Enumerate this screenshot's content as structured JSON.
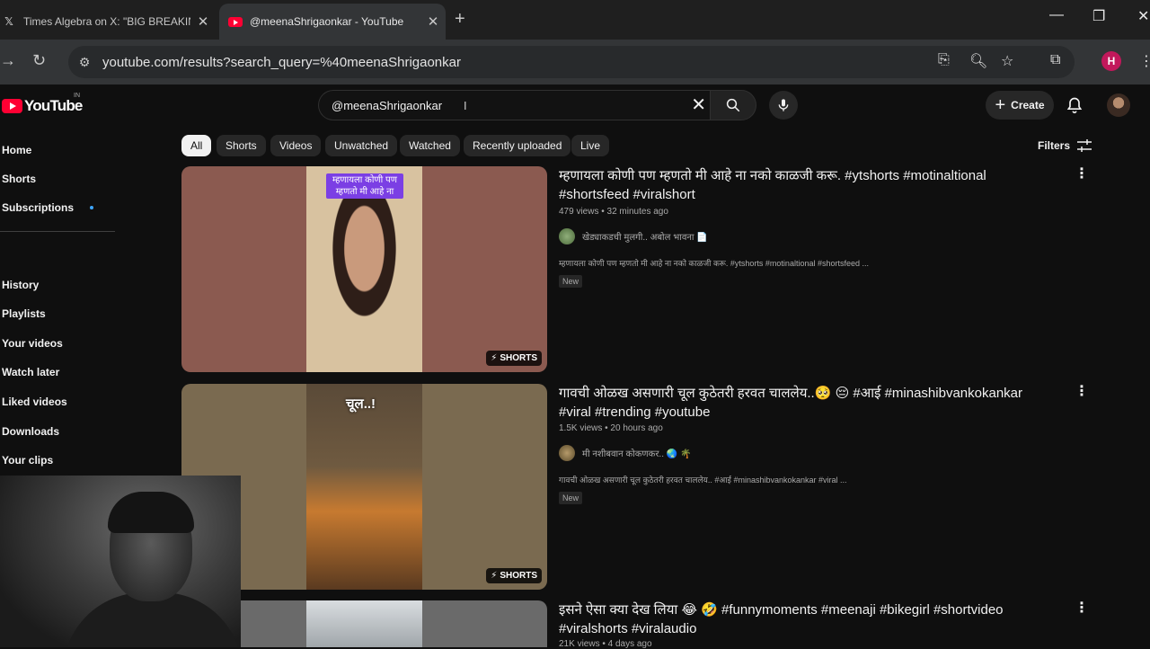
{
  "browser": {
    "tabs": [
      {
        "title": "Times Algebra on X: \"BIG BREAKING N",
        "icon": "x-logo-icon",
        "active": false
      },
      {
        "title": "@meenaShrigaonkar - YouTube",
        "icon": "youtube-icon",
        "active": true
      }
    ],
    "url": "youtube.com/results?search_query=%40meenaShrigaonkar",
    "profile_initial": "H"
  },
  "youtube": {
    "logo_text": "YouTube",
    "country_code": "IN",
    "search_query": "@meenaShrigaonkar",
    "create_label": "Create"
  },
  "sidebar": {
    "items": [
      {
        "label": "Home"
      },
      {
        "label": "Shorts"
      },
      {
        "label": "Subscriptions"
      },
      {
        "label": "History"
      },
      {
        "label": "Playlists"
      },
      {
        "label": "Your videos"
      },
      {
        "label": "Watch later"
      },
      {
        "label": "Liked videos"
      },
      {
        "label": "Downloads"
      },
      {
        "label": "Your clips"
      }
    ]
  },
  "chips": [
    "All",
    "Shorts",
    "Videos",
    "Unwatched",
    "Watched",
    "Recently uploaded",
    "Live"
  ],
  "filters_label": "Filters",
  "results": [
    {
      "title_line1": "म्हणायला कोणी पण म्हणतो मी आहे ना नको काळजी करू. #ytshorts #motinaltional",
      "title_line2": "#shortsfeed #viralshort",
      "meta": "479 views • 32 minutes ago",
      "channel": "खेड्याकडची मुलगी.. अबोल भावना 📄",
      "description": "म्हणायला कोणी पण म्हणतो मी आहे ना नको काळजी करू. #ytshorts #motinaltional #shortsfeed ...",
      "badge": "New",
      "shorts_label": "SHORTS",
      "overlay_line1": "म्हणायला कोणी पण",
      "overlay_line2": "म्हणतो मी आहे ना"
    },
    {
      "title_line1": "गावची ओळख असणारी चूल कुठेतरी हरवत चाललेय..🥺 😔 #आई #minashibvankokankar",
      "title_line2": "#viral #trending #youtube",
      "meta": "1.5K views • 20 hours ago",
      "channel": "मी नशीबवान कोकणकर.. 🌏 🌴",
      "description": "गावची ओळख असणारी चूल कुठेतरी हरवत चाललेय.. #आई #minashibvankokankar #viral ...",
      "badge": "New",
      "shorts_label": "SHORTS",
      "overlay_text": "चूल..!"
    },
    {
      "title_line1": "इसने ऐसा क्या देख लिया 😂 🤣 #funnymoments #meenaji #bikegirl #shortvideo",
      "title_line2": "#viralshorts #viralaudio",
      "meta": "21K views • 4 days ago"
    }
  ]
}
